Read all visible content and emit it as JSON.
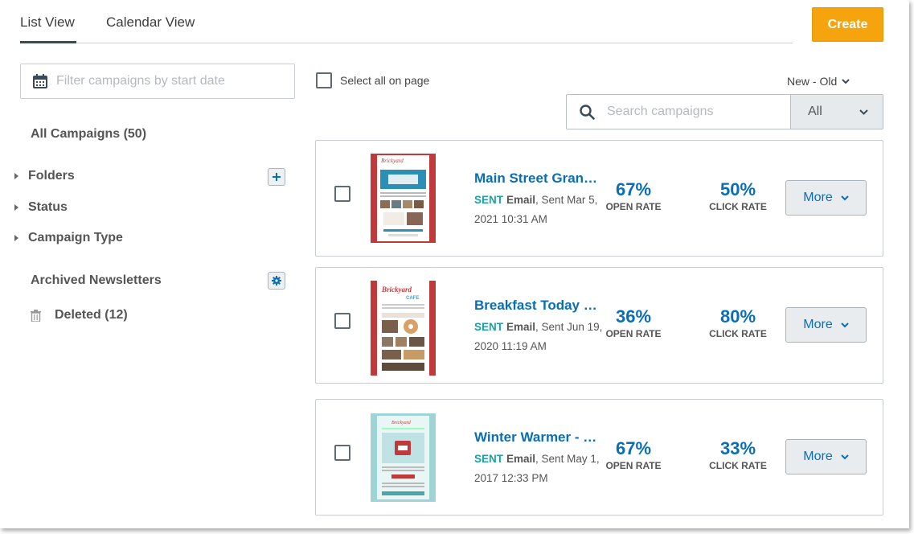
{
  "tabs": [
    {
      "label": "List View",
      "active": true
    },
    {
      "label": "Calendar View",
      "active": false
    }
  ],
  "create_label": "Create",
  "date_filter": {
    "placeholder": "Filter campaigns by start date"
  },
  "sidebar": {
    "all_campaigns": "All Campaigns (50)",
    "folders": "Folders",
    "status": "Status",
    "campaign_type": "Campaign Type",
    "archived": "Archived Newsletters",
    "deleted": "Deleted (12)"
  },
  "select_all_label": "Select all on page",
  "sort_label": "New - Old",
  "search": {
    "placeholder": "Search campaigns",
    "filter_value": "All"
  },
  "campaigns": [
    {
      "title": "Main Street Grand Reopening",
      "status": "SENT",
      "type": "Email",
      "sent_text": ", Sent Mar 5, 2021 10:31 AM",
      "open_rate": "67%",
      "open_label": "OPEN RATE",
      "click_rate": "50%",
      "click_label": "CLICK RATE",
      "more_label": "More",
      "thumb_color": "#c0393b"
    },
    {
      "title": "Breakfast Today Recipes",
      "status": "SENT",
      "type": "Email",
      "sent_text": ", Sent Jun 19, 2020 11:19 AM",
      "open_rate": "36%",
      "open_label": "OPEN RATE",
      "click_rate": "80%",
      "click_label": "CLICK RATE",
      "more_label": "More",
      "thumb_color": "#c0393b"
    },
    {
      "title": "Winter Warmer - Specials",
      "status": "SENT",
      "type": "Email",
      "sent_text": ", Sent May 1, 2017 12:33 PM",
      "open_rate": "67%",
      "open_label": "OPEN RATE",
      "click_rate": "33%",
      "click_label": "CLICK RATE",
      "more_label": "More",
      "thumb_color": "#9fd4d6"
    }
  ],
  "colors": {
    "accent": "#0a6eb4",
    "create": "#f5a40e",
    "sent": "#1aa0a6"
  }
}
